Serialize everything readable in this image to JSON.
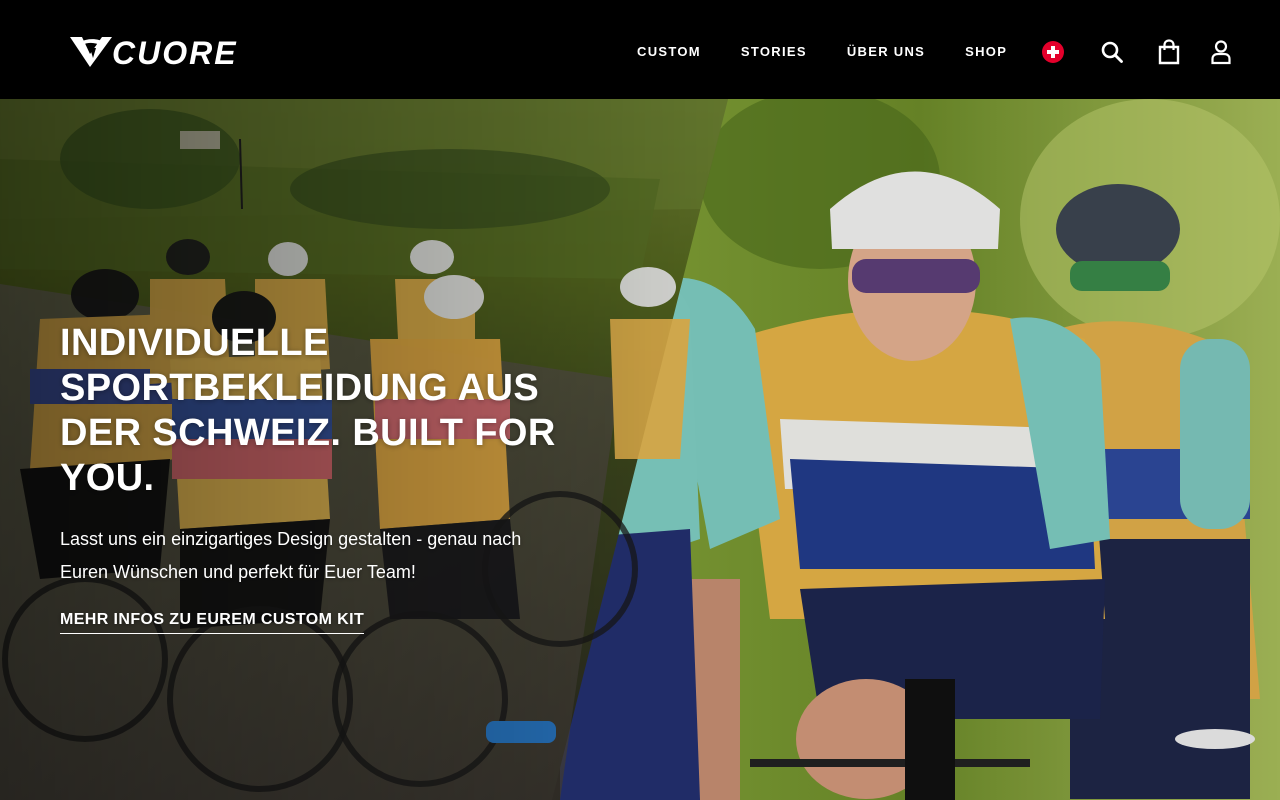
{
  "brand": {
    "name": "CUORE"
  },
  "nav": {
    "items": [
      {
        "label": "CUSTOM"
      },
      {
        "label": "STORIES"
      },
      {
        "label": "ÜBER UNS"
      },
      {
        "label": "SHOP"
      }
    ]
  },
  "utilities": {
    "country_icon": "swiss-flag-icon",
    "search_icon": "search-icon",
    "cart_icon": "shopping-bag-icon",
    "account_icon": "user-icon"
  },
  "hero": {
    "title": "INDIVIDUELLE SPORTBEKLEIDUNG AUS DER SCHWEIZ. BUILT FOR YOU.",
    "subtitle": "Lasst uns ein einzigartiges Design gestalten - genau nach Euren Wünschen und perfekt für Euer Team!",
    "cta_label": "MEHR INFOS ZU EUREM CUSTOM KIT"
  },
  "colors": {
    "header_bg": "#000000",
    "text": "#ffffff",
    "flag_red": "#e4002b"
  }
}
